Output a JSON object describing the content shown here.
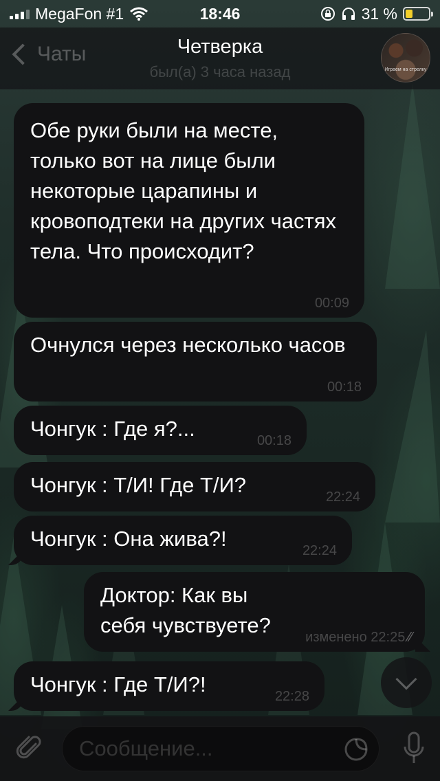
{
  "status_bar": {
    "carrier": "MegaFon #1",
    "time": "18:46",
    "battery_percent": "31 %",
    "battery_level": 0.31,
    "battery_color": "#f3cf2b"
  },
  "header": {
    "back_label": "Чаты",
    "title": "Четверка",
    "subtitle": "был(а) 3 часа назад",
    "avatar_caption": "Играем на стрелку"
  },
  "messages": [
    {
      "direction": "in",
      "text": "Обе руки были на месте, только вот на лице были некоторые царапины и кровоподтеки на других частях тела. Что происходит?",
      "time": "00:09"
    },
    {
      "direction": "in",
      "text": "Очнулся через несколько часов",
      "time": "00:18"
    },
    {
      "direction": "in",
      "text": "Чонгук : Где я?...",
      "time": "00:18"
    },
    {
      "direction": "in",
      "text": "Чонгук : Т/И! Где Т/И?",
      "time": "22:24"
    },
    {
      "direction": "in",
      "text": "Чонгук : Она жива?!",
      "time": "22:24"
    },
    {
      "direction": "out",
      "text": "Доктор: Как вы себя чувствуете?",
      "time": "изменено 22:25",
      "checks": "⁄⁄"
    },
    {
      "direction": "in",
      "text": "Чонгук : Где Т/И?!",
      "time": "22:28"
    }
  ],
  "composer": {
    "placeholder": "Сообщение..."
  },
  "icons": {
    "wifi": "wifi-icon",
    "lock_rotation": "rotation-lock-icon",
    "headphones": "headphones-icon",
    "attach": "paperclip-icon",
    "sticker": "sticker-icon",
    "mic": "microphone-icon",
    "scroll_down": "chevron-down-icon"
  }
}
